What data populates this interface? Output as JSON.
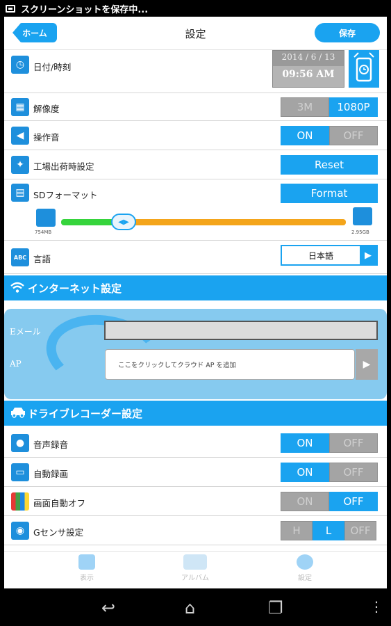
{
  "status_bar": {
    "text": "スクリーンショットを保存中..."
  },
  "header": {
    "home_label": "ホーム",
    "title": "設定",
    "save_label": "保存"
  },
  "settings": {
    "datetime": {
      "label": "日付/時刻",
      "date": "2014 / 6 / 13",
      "time": "09:56 AM"
    },
    "resolution": {
      "label": "解像度",
      "options": [
        "3M",
        "1080P"
      ],
      "selected": "1080P"
    },
    "sound": {
      "label": "操作音",
      "options": [
        "ON",
        "OFF"
      ],
      "selected": "ON"
    },
    "factory": {
      "label": "工場出荷時設定",
      "button": "Reset"
    },
    "sd": {
      "label": "SDフォーマット",
      "button": "Format",
      "used": "754MB",
      "total": "2.95GB",
      "used_fraction": 0.26
    },
    "language": {
      "label": "言語",
      "value": "日本語"
    }
  },
  "internet": {
    "title": "インターネット設定",
    "email_label": "Eメール",
    "email_value": "",
    "ap_label": "AP",
    "ap_placeholder": "ここをクリックしてクラウド AP を追加"
  },
  "drive": {
    "title": "ドライブレコーダー設定",
    "audio": {
      "label": "音声録音",
      "options": [
        "ON",
        "OFF"
      ],
      "selected": "ON"
    },
    "auto_record": {
      "label": "自動録画",
      "options": [
        "ON",
        "OFF"
      ],
      "selected": "ON"
    },
    "screen_off": {
      "label": "画面自動オフ",
      "options": [
        "ON",
        "OFF"
      ],
      "selected": "OFF"
    },
    "gsensor": {
      "label": "Gセンサ設定",
      "options": [
        "H",
        "L",
        "OFF"
      ],
      "selected": "L"
    }
  },
  "bottom_nav": {
    "view": "表示",
    "album": "アルバム",
    "settings": "設定"
  },
  "colors": {
    "accent": "#1aa3f0",
    "disabled": "#a4a4a4",
    "green": "#36d43c",
    "orange": "#f4a51b"
  }
}
